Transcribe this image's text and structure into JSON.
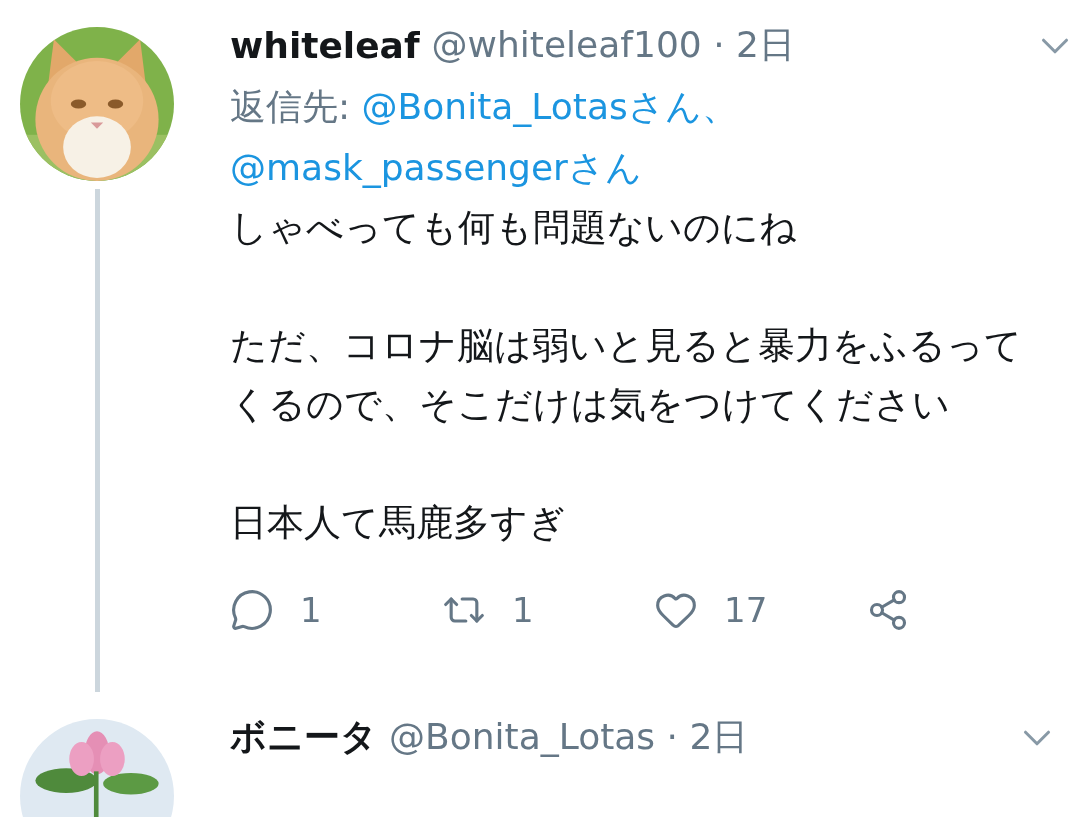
{
  "tweets": [
    {
      "name": "whiteleaf",
      "meta": "@whiteleaf100 · 2日",
      "reply_label": "返信先:",
      "reply_to": [
        "@Bonita_Lotasさん、",
        "@mask_passengerさん"
      ],
      "paragraphs": [
        "しゃべっても何も問題ないのにね",
        "ただ、コロナ脳は弱いと見ると暴力をふるってくるので、そこだけは気をつけてください",
        "日本人て馬鹿多すぎ"
      ],
      "actions": [
        {
          "kind": "reply",
          "count": "1"
        },
        {
          "kind": "retweet",
          "count": "1"
        },
        {
          "kind": "like",
          "count": "17"
        },
        {
          "kind": "share"
        }
      ]
    },
    {
      "name": "ボニータ",
      "meta": "@Bonita_Lotas · 2日"
    }
  ]
}
